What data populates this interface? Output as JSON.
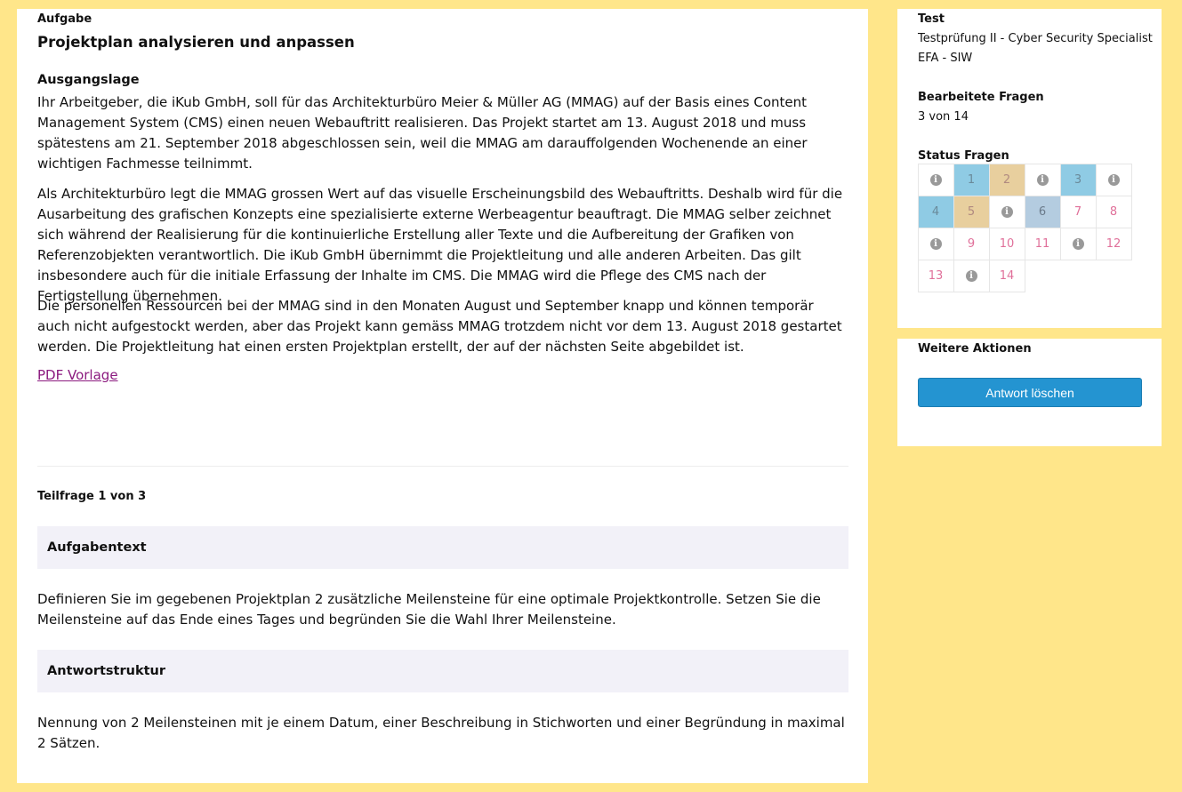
{
  "main": {
    "aufgabe_label": "Aufgabe",
    "title": "Projektplan analysieren und anpassen",
    "ausgangslage_label": "Ausgangslage",
    "paragraphs": [
      "Ihr Arbeitgeber, die iKub GmbH, soll für das Architekturbüro Meier & Müller AG (MMAG) auf der Basis eines Content Management System (CMS) einen neuen Webauftritt realisieren. Das Projekt startet am 13. August 2018 und muss spätestens am 21. September 2018 abgeschlossen sein, weil die MMAG am darauffolgenden Wochenende an einer wichtigen Fachmesse teilnimmt.",
      "Als Architekturbüro legt die MMAG grossen Wert auf das visuelle Erscheinungsbild des Webauftritts. Deshalb wird für die Ausarbeitung des grafischen Konzepts eine spezialisierte externe Werbeagentur beauftragt. Die MMAG selber zeichnet sich während der Realisierung für die kontinuierliche Erstellung aller Texte und die Aufbereitung der Grafiken von Referenzobjekten verantwortlich. Die iKub GmbH übernimmt die Projektleitung und alle anderen Arbeiten. Das gilt insbesondere auch für die initiale Erfassung der Inhalte im CMS. Die MMAG wird die Pflege des CMS nach der Fertigstellung übernehmen.",
      "Die personellen Ressourcen bei der MMAG sind in den Monaten August und September knapp und können temporär auch nicht aufgestockt werden, aber das Projekt kann gemäss MMAG trotzdem nicht vor dem 13. August 2018 gestartet werden. Die Projektleitung hat einen ersten Projektplan erstellt, der auf der nächsten Seite abgebildet ist."
    ],
    "pdf_link": "PDF Vorlage",
    "teilfrage": "Teilfrage 1 von 3",
    "aufgabentext_label": "Aufgabentext",
    "aufgabentext": "Definieren Sie im gegebenen Projektplan 2 zusätzliche Meilensteine für eine optimale Projektkontrolle. Setzen Sie die Meilensteine auf das Ende eines Tages und begründen Sie die Wahl Ihrer Meilensteine.",
    "antwortstruktur_label": "Antwortstruktur",
    "antwortstruktur": "Nennung von 2 Meilensteinen mit je einem Datum, einer Beschreibung in Stichworten und einer Begründung in maximal 2 Sätzen."
  },
  "sidebar": {
    "test_label": "Test",
    "test_name_line1": "Testprüfung II - Cyber Security Specialist",
    "test_name_line2": "EFA - SIW",
    "bearbeitet_label": "Bearbeitete Fragen",
    "bearbeitet_value": "3 von 14",
    "status_label": "Status Fragen",
    "status_cells": [
      {
        "kind": "info"
      },
      {
        "kind": "num",
        "label": "1",
        "state": "blue"
      },
      {
        "kind": "num",
        "label": "2",
        "state": "tan"
      },
      {
        "kind": "info"
      },
      {
        "kind": "num",
        "label": "3",
        "state": "blue"
      },
      {
        "kind": "info"
      },
      {
        "kind": "num",
        "label": "4",
        "state": "blue"
      },
      {
        "kind": "num",
        "label": "5",
        "state": "tan"
      },
      {
        "kind": "info"
      },
      {
        "kind": "num",
        "label": "6",
        "state": "steel"
      },
      {
        "kind": "num",
        "label": "7",
        "state": "none"
      },
      {
        "kind": "num",
        "label": "8",
        "state": "none"
      },
      {
        "kind": "info"
      },
      {
        "kind": "num",
        "label": "9",
        "state": "none"
      },
      {
        "kind": "num",
        "label": "10",
        "state": "none"
      },
      {
        "kind": "num",
        "label": "11",
        "state": "none"
      },
      {
        "kind": "info"
      },
      {
        "kind": "num",
        "label": "12",
        "state": "none"
      },
      {
        "kind": "num",
        "label": "13",
        "state": "none"
      },
      {
        "kind": "info"
      },
      {
        "kind": "num",
        "label": "14",
        "state": "none"
      }
    ],
    "info_icon_glyph": "i",
    "weitere_label": "Weitere Aktionen",
    "delete_button": "Antwort löschen"
  },
  "colors": {
    "background": "#ffe68a",
    "button": "#2494d1",
    "link": "#8b1a7f",
    "answered": "#8fcbe4",
    "flagged": "#e8cf9e"
  }
}
